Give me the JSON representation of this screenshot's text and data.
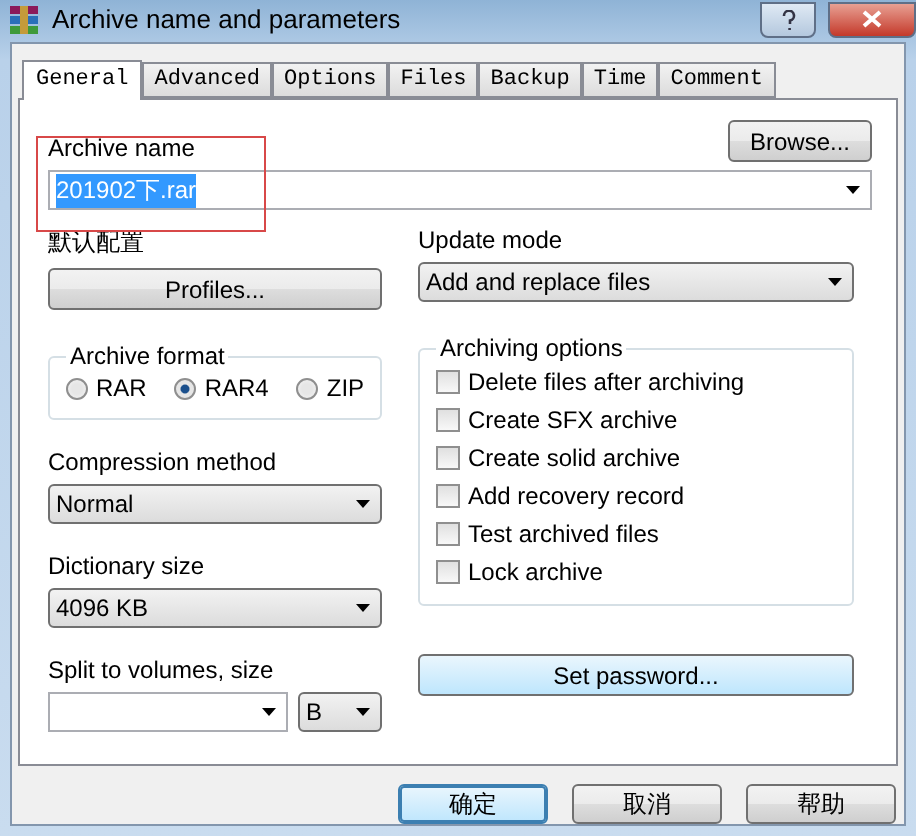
{
  "window": {
    "title": "Archive name and parameters"
  },
  "tabs": [
    {
      "label": "General",
      "selected": true
    },
    {
      "label": "Advanced",
      "selected": false
    },
    {
      "label": "Options",
      "selected": false
    },
    {
      "label": "Files",
      "selected": false
    },
    {
      "label": "Backup",
      "selected": false
    },
    {
      "label": "Time",
      "selected": false
    },
    {
      "label": "Comment",
      "selected": false
    }
  ],
  "archive_name": {
    "label": "Archive name",
    "value": "201902下.rar",
    "browse_button": "Browse...",
    "highlighted": true
  },
  "profiles": {
    "label": "默认配置",
    "button": "Profiles..."
  },
  "update_mode": {
    "label": "Update mode",
    "value": "Add and replace files"
  },
  "archive_format": {
    "label": "Archive format",
    "options": [
      {
        "label": "RAR",
        "selected": false
      },
      {
        "label": "RAR4",
        "selected": true
      },
      {
        "label": "ZIP",
        "selected": false
      }
    ]
  },
  "compression_method": {
    "label": "Compression method",
    "value": "Normal"
  },
  "dictionary_size": {
    "label": "Dictionary size",
    "value": "4096 KB"
  },
  "split_volumes": {
    "label": "Split to volumes, size",
    "unit": "B"
  },
  "archiving_options": {
    "label": "Archiving options",
    "items": [
      {
        "label": "Delete files after archiving",
        "checked": false
      },
      {
        "label": "Create SFX archive",
        "checked": false
      },
      {
        "label": "Create solid archive",
        "checked": false
      },
      {
        "label": "Add recovery record",
        "checked": false
      },
      {
        "label": "Test archived files",
        "checked": false
      },
      {
        "label": "Lock archive",
        "checked": false
      }
    ]
  },
  "password_button": "Set password...",
  "buttons": [
    {
      "label": "确定",
      "default": true
    },
    {
      "label": "取消",
      "default": false
    },
    {
      "label": "帮助",
      "default": false
    }
  ]
}
